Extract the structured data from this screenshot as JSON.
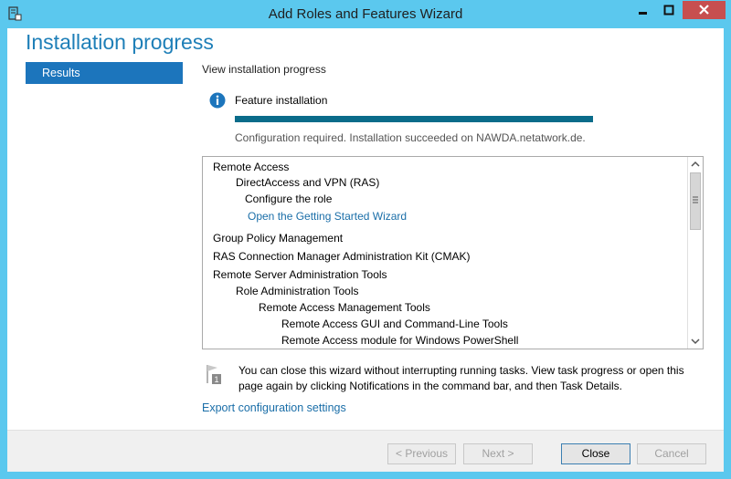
{
  "window": {
    "title": "Add Roles and Features Wizard",
    "accent_color": "#5bc8ee",
    "close_color": "#c74f4f"
  },
  "page": {
    "title": "Installation progress"
  },
  "sidebar": {
    "items": [
      {
        "label": "Results",
        "selected": true
      }
    ]
  },
  "main": {
    "heading": "View installation progress",
    "feature": {
      "icon": "info-icon",
      "label": "Feature installation",
      "progress": 1.0,
      "status": "Configuration required. Installation succeeded on NAWDA.netatwork.de."
    },
    "results": [
      {
        "label": "Remote Access",
        "level": 0
      },
      {
        "label": "DirectAccess and VPN (RAS)",
        "level": 1
      },
      {
        "label": "Configure the role",
        "level": 2
      },
      {
        "label": "Open the Getting Started Wizard",
        "level": 2,
        "link": true
      },
      {
        "label": "Group Policy Management",
        "level": 0
      },
      {
        "label": "RAS Connection Manager Administration Kit (CMAK)",
        "level": 0
      },
      {
        "label": "Remote Server Administration Tools",
        "level": 0
      },
      {
        "label": "Role Administration Tools",
        "level": 1
      },
      {
        "label": "Remote Access Management Tools",
        "level": 2
      },
      {
        "label": "Remote Access GUI and Command-Line Tools",
        "level": 3
      },
      {
        "label": "Remote Access module for Windows PowerShell",
        "level": 3
      }
    ],
    "notice": {
      "icon": "notification-flag-icon",
      "badge": "1",
      "text": "You can close this wizard without interrupting running tasks. View task progress or open this page again by clicking Notifications in the command bar, and then Task Details."
    },
    "export_link": "Export configuration settings"
  },
  "footer": {
    "previous_label": "< Previous",
    "next_label": "Next >",
    "close_label": "Close",
    "cancel_label": "Cancel"
  }
}
